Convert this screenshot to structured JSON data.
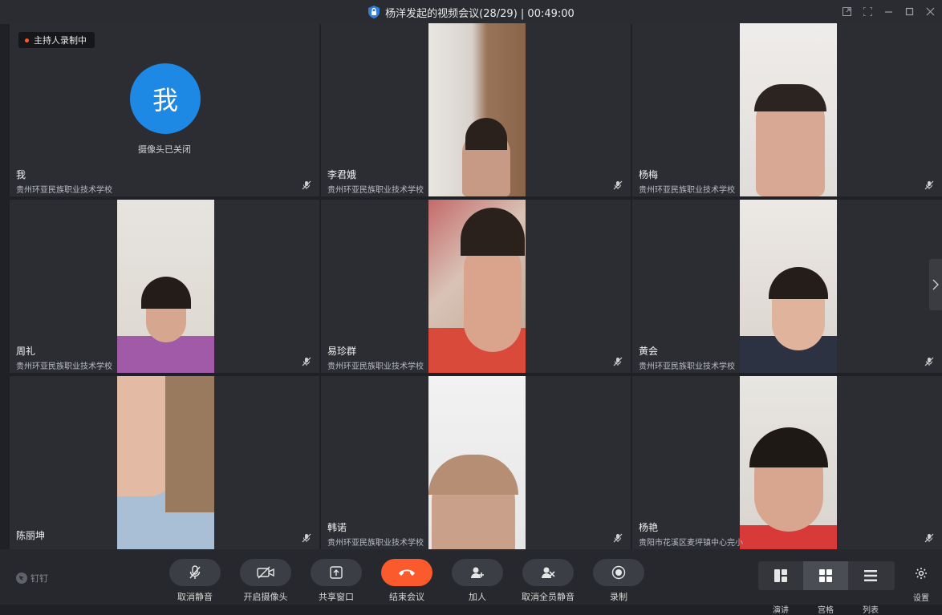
{
  "window": {
    "title": "杨洋发起的视频会议(28/29) | 00:49:00"
  },
  "recording_badge": "主持人录制中",
  "self_tile": {
    "avatar_text": "我",
    "camera_status": "摄像头已关闭"
  },
  "participants": [
    {
      "name": "我",
      "org": "贵州环亚民族职业技术学校"
    },
    {
      "name": "李君娥",
      "org": "贵州环亚民族职业技术学校"
    },
    {
      "name": "杨梅",
      "org": "贵州环亚民族职业技术学校"
    },
    {
      "name": "周礼",
      "org": "贵州环亚民族职业技术学校"
    },
    {
      "name": "易珍群",
      "org": "贵州环亚民族职业技术学校"
    },
    {
      "name": "黄会",
      "org": "贵州环亚民族职业技术学校"
    },
    {
      "name": "陈丽坤",
      "org": ""
    },
    {
      "name": "韩诺",
      "org": "贵州环亚民族职业技术学校"
    },
    {
      "name": "杨艳",
      "org": "贵阳市花溪区麦坪镇中心完小"
    }
  ],
  "toolbar": {
    "brand": "钉钉",
    "buttons": [
      "取消静音",
      "开启摄像头",
      "共享窗口",
      "结束会议",
      "加人",
      "取消全员静音",
      "录制"
    ],
    "layouts": [
      "演讲",
      "宫格",
      "列表"
    ],
    "settings": "设置"
  },
  "colors": {
    "accent_blue": "#1e88e5",
    "end_call_red": "#fa5a2c",
    "recording_dot": "#ff5a1f"
  }
}
